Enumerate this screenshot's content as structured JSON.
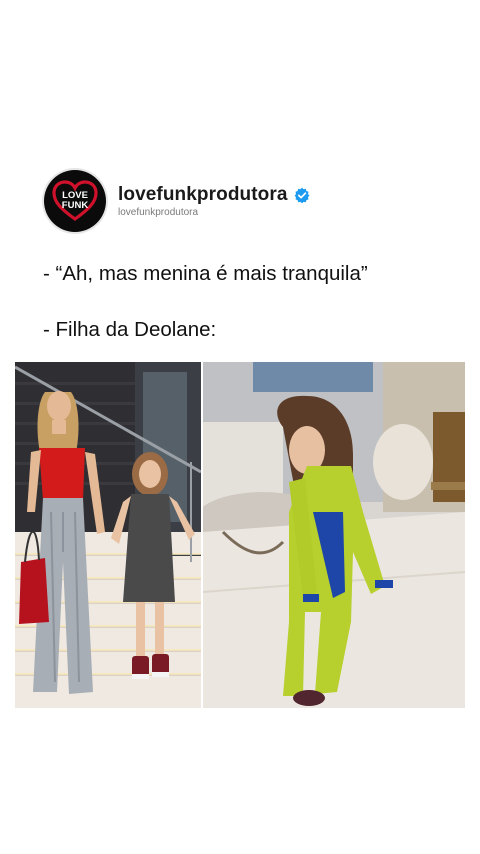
{
  "post": {
    "username": "lovefunkprodutora",
    "handle": "lovefunkprodutora",
    "verified": true,
    "avatar_logo": {
      "line1": "LOVE",
      "line2": "FUNK",
      "heart_color": "#d0112b"
    },
    "caption_lines": [
      "- “Ah, mas menina é mais tranquila”",
      "- Filha da Deolane:"
    ]
  },
  "images": {
    "left": {
      "description": "mother-and-daughter-staircase"
    },
    "right": {
      "description": "girl-in-green-costume"
    }
  }
}
